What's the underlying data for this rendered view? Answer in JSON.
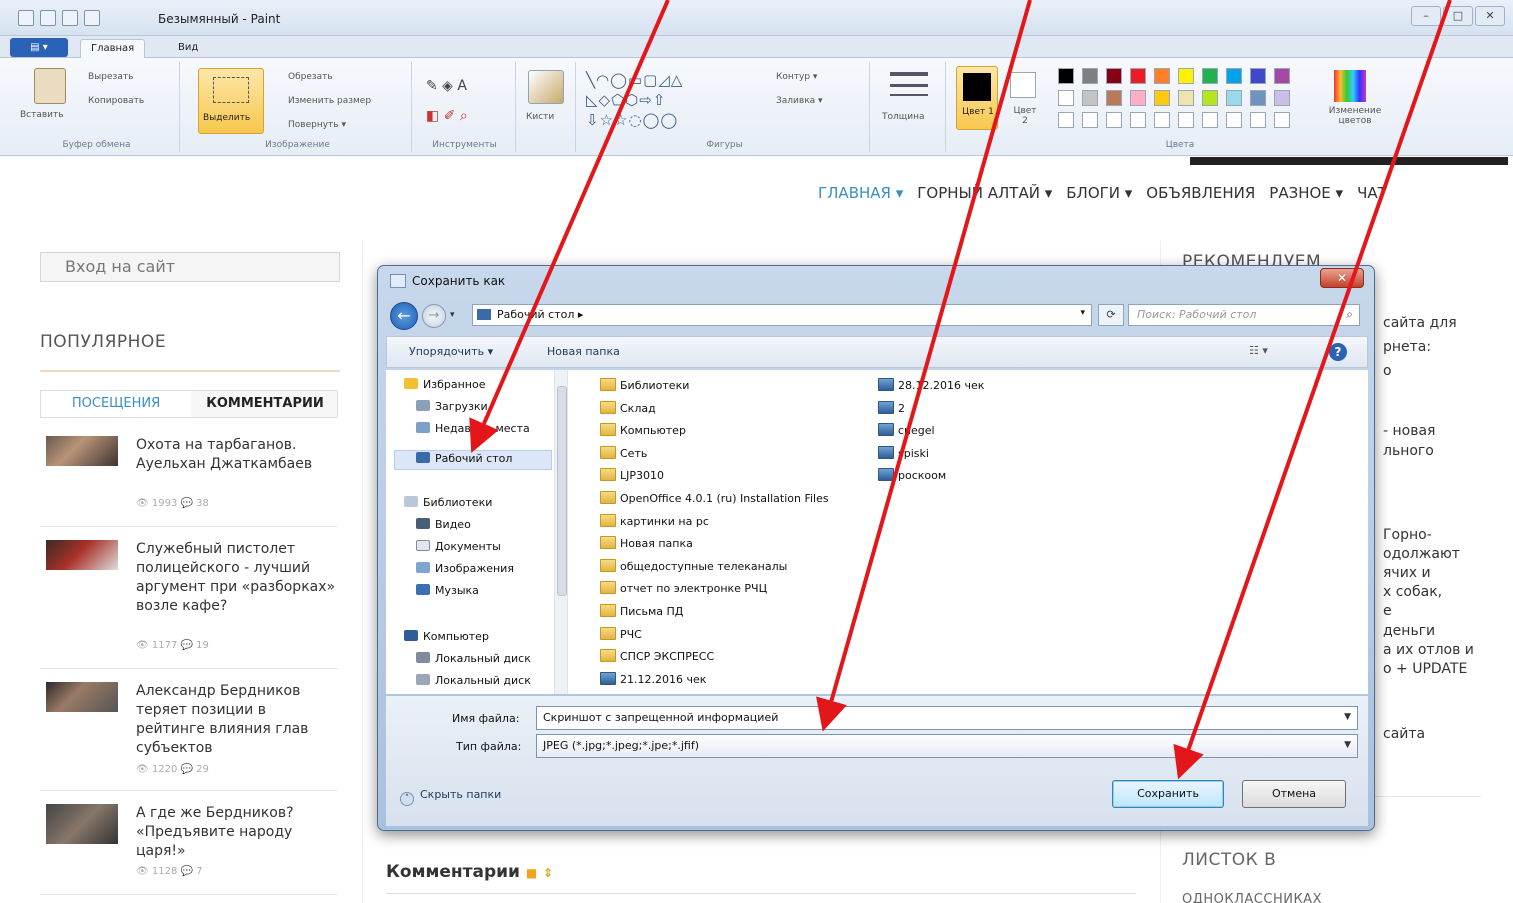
{
  "paint": {
    "title": "Безымянный - Paint",
    "tabs": [
      "Главная",
      "Вид"
    ],
    "groups": {
      "clipboard": {
        "label": "Буфер обмена",
        "paste": "Вставить",
        "cut": "Вырезать",
        "copy": "Копировать"
      },
      "image": {
        "label": "Изображение",
        "select": "Выделить",
        "crop": "Обрезать",
        "resize": "Изменить размер",
        "rotate": "Повернуть ▾"
      },
      "tools": {
        "label": "Инструменты",
        "brushes": "Кисти"
      },
      "shapes": {
        "label": "Фигуры",
        "outline": "Контур ▾",
        "fill": "Заливка ▾"
      },
      "size": {
        "label": "Толщина"
      },
      "colors": {
        "label": "Цвета",
        "color1": "Цвет 1",
        "color2": "Цвет 2",
        "edit": "Изменение цветов"
      }
    },
    "palette_row1": [
      "#000000",
      "#7f7f7f",
      "#880015",
      "#ed1c24",
      "#ff7f27",
      "#fff200",
      "#22b14c",
      "#00a2e8",
      "#3f48cc",
      "#a349a4"
    ],
    "palette_row2": [
      "#ffffff",
      "#c3c3c3",
      "#b97a57",
      "#ffaec9",
      "#ffc90e",
      "#efe4b0",
      "#b5e61d",
      "#99d9ea",
      "#7092be",
      "#c8bfe7"
    ]
  },
  "site": {
    "nav": [
      "ГЛАВНАЯ ▾",
      "ГОРНЫЙ АЛТАЙ ▾",
      "БЛОГИ ▾",
      "ОБЪЯВЛЕНИЯ",
      "РАЗНОЕ ▾",
      "ЧАТ"
    ],
    "login": "Вход на сайт",
    "popular": "ПОПУЛЯРНОЕ",
    "tab_visits": "ПОСЕЩЕНИЯ",
    "tab_comments": "КОММЕНТАРИИ",
    "posts": [
      {
        "title": "Охота на тарбаганов. Ауельхан Джаткамбаев",
        "views": "1993",
        "comments": "38"
      },
      {
        "title": "Служебный пистолет полицейского - лучший аргумент при «разборках» возле кафе?",
        "views": "1177",
        "comments": "19"
      },
      {
        "title": "Александр Бердников теряет позиции в рейтинге влияния глав субъектов",
        "views": "1220",
        "comments": "29"
      },
      {
        "title": "А где же Бердников? «Предъявите народу царя!»",
        "views": "1128",
        "comments": "7"
      }
    ],
    "right_title": "РЕКОМЕНДУЕМ",
    "right_snippets": [
      "сайта для",
      "рнета:",
      "о",
      "- новая",
      "льного",
      "Горно-",
      "одолжают",
      "ячих и",
      "х собак,",
      "е",
      "деньги",
      "а их отлов и",
      "о + UPDATE",
      "сайта"
    ],
    "listok": "ЛИСТОК В",
    "listok2": "ОДНОКЛАССНИКАХ",
    "comments_heading": "Комментарии"
  },
  "dialog": {
    "title": "Сохранить как",
    "close": "✕",
    "address": "Рабочий стол ▸",
    "search_placeholder": "Поиск: Рабочий стол",
    "organize": "Упорядочить ▾",
    "new_folder": "Новая папка",
    "nav_items": [
      {
        "label": "Избранное"
      },
      {
        "label": "Загрузки"
      },
      {
        "label": "Недавние места"
      },
      {
        "label": "Рабочий стол"
      },
      {
        "label": "Библиотеки"
      },
      {
        "label": "Видео"
      },
      {
        "label": "Документы"
      },
      {
        "label": "Изображения"
      },
      {
        "label": "Музыка"
      },
      {
        "label": "Компьютер"
      },
      {
        "label": "Локальный диск"
      },
      {
        "label": "Локальный диск"
      }
    ],
    "files_col1": [
      "Библиотеки",
      "Склад",
      "Компьютер",
      "Сеть",
      "LJP3010",
      "OpenOffice 4.0.1 (ru) Installation Files",
      "картинки на рс",
      "Новая папка",
      "общедоступные телеканалы",
      "отчет по электронке РЧЦ",
      "Письма ПД",
      "РЧС",
      "СПСР ЭКСПРЕСС",
      "21.12.2016 чек"
    ],
    "files_col2": [
      "28.12.2016 чек",
      "2",
      "cnegel",
      "spiski",
      "роскоом"
    ],
    "filename_label": "Имя файла:",
    "filename_value": "Скриншот с запрещенной информацией",
    "filetype_label": "Тип файла:",
    "filetype_value": "JPEG (*.jpg;*.jpeg;*.jpe;*.jfif)",
    "hide_folders": "Скрыть папки",
    "save": "Сохранить",
    "cancel": "Отмена"
  },
  "colors": {
    "arrow": "#e3161a",
    "accent": "#3a8ec7"
  }
}
